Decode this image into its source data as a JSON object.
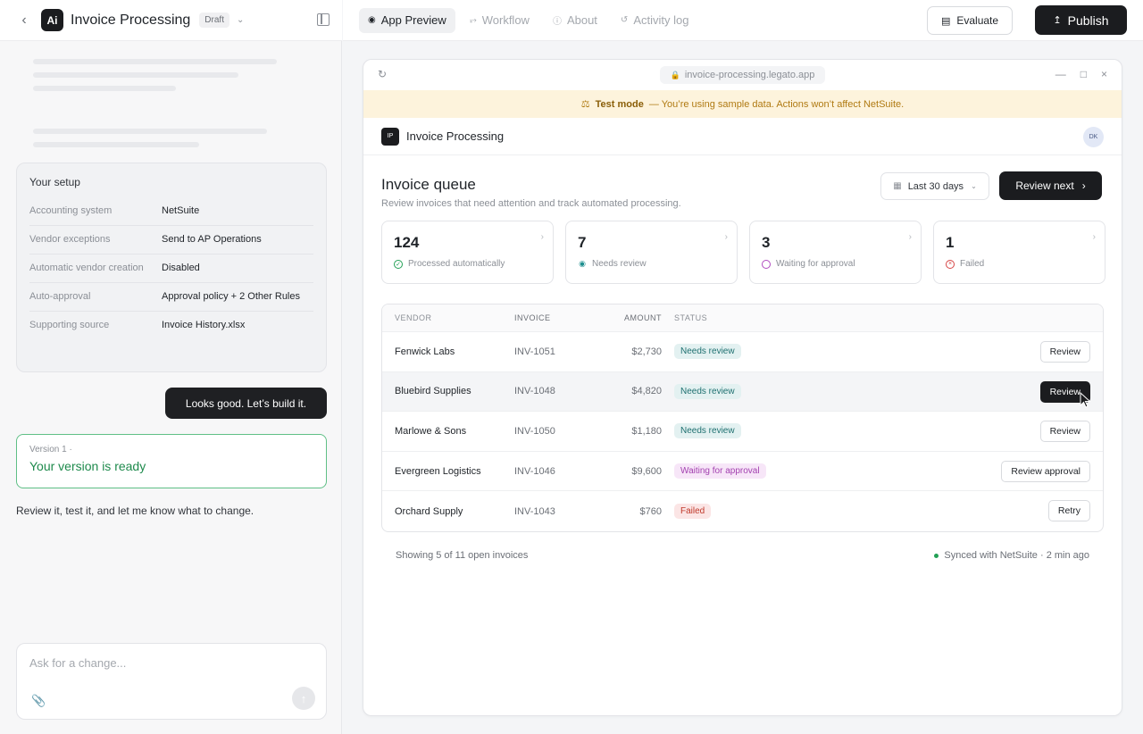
{
  "header": {
    "app_title": "Invoice Processing",
    "draft_label": "Draft",
    "logo_text": "Ai"
  },
  "setup": {
    "title": "Your setup",
    "rows": [
      {
        "label": "Accounting system",
        "value": "NetSuite"
      },
      {
        "label": "Vendor exceptions",
        "value": "Send to AP Operations"
      },
      {
        "label": "Automatic vendor creation",
        "value": "Disabled"
      },
      {
        "label": "Auto-approval",
        "value": "Approval policy + 2 Other Rules"
      },
      {
        "label": "Supporting source",
        "value": "Invoice History.xlsx"
      }
    ]
  },
  "chat": {
    "user_message": "Looks good. Let’s build it.",
    "version_label": "Version 1 ·",
    "version_ready": "Your version is ready",
    "assistant_message": "Review it, test it, and let me know what to change.",
    "input_placeholder": "Ask for a change..."
  },
  "nav": {
    "tabs": [
      {
        "label": "App Preview",
        "icon": "eye-icon",
        "active": true
      },
      {
        "label": "Workflow",
        "icon": "workflow-icon",
        "active": false
      },
      {
        "label": "About",
        "icon": "info-icon",
        "active": false
      },
      {
        "label": "Activity log",
        "icon": "history-icon",
        "active": false
      }
    ],
    "evaluate_label": "Evaluate",
    "publish_label": "Publish"
  },
  "browser": {
    "url": "invoice-processing.legato.app"
  },
  "banner": {
    "prefix": "Test mode",
    "text": "— You’re using sample data. Actions won’t affect NetSuite."
  },
  "app": {
    "logo_text": "IP",
    "title": "Invoice Processing",
    "avatar": "DK",
    "queue_title": "Invoice queue",
    "queue_subtitle": "Review invoices that need attention and track automated processing.",
    "date_range": "Last 30 days",
    "review_next": "Review next"
  },
  "stats": [
    {
      "value": "124",
      "label": "Processed automatically",
      "color": "#22a055"
    },
    {
      "value": "7",
      "label": "Needs review",
      "color": "#1e8f8f"
    },
    {
      "value": "3",
      "label": "Waiting for approval",
      "color": "#b04bc0"
    },
    {
      "value": "1",
      "label": "Failed",
      "color": "#d64545"
    }
  ],
  "table": {
    "headers": {
      "vendor": "VENDOR",
      "invoice": "INVOICE",
      "amount": "AMOUNT",
      "status": "STATUS"
    },
    "rows": [
      {
        "vendor": "Fenwick Labs",
        "invoice": "INV-1051",
        "amount": "$2,730",
        "status": "Needs review",
        "action": "Review"
      },
      {
        "vendor": "Bluebird Supplies",
        "invoice": "INV-1048",
        "amount": "$4,820",
        "status": "Needs review",
        "action": "Review"
      },
      {
        "vendor": "Marlowe & Sons",
        "invoice": "INV-1050",
        "amount": "$1,180",
        "status": "Needs review",
        "action": "Review"
      },
      {
        "vendor": "Evergreen Logistics",
        "invoice": "INV-1046",
        "amount": "$9,600",
        "status": "Waiting for approval",
        "action": "Review approval"
      },
      {
        "vendor": "Orchard Supply",
        "invoice": "INV-1043",
        "amount": "$760",
        "status": "Failed",
        "action": "Retry"
      }
    ]
  },
  "footer": {
    "showing": "Showing 5 of 11 open invoices",
    "synced": "Synced with NetSuite · 2 min ago"
  }
}
